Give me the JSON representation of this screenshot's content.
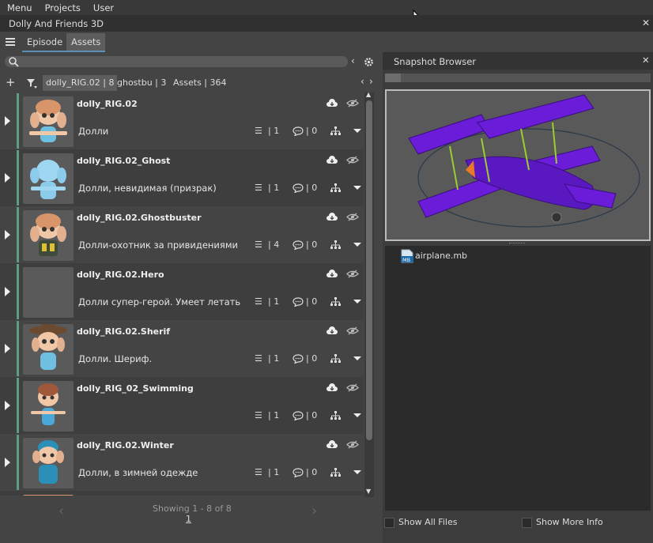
{
  "menubar": {
    "items": [
      "Menu",
      "Projects",
      "User"
    ]
  },
  "window": {
    "title": "Dolly And Friends 3D"
  },
  "tabs": [
    "Episode",
    "Assets"
  ],
  "filters": {
    "chips": [
      "dolly_RIG.02 | 8",
      "ghostbu | 3",
      "Assets | 364"
    ]
  },
  "assets": [
    {
      "name": "dolly_RIG.02",
      "description": "Долли",
      "versions": "1",
      "comments": "0"
    },
    {
      "name": "dolly_RIG.02_Ghost",
      "description": "Долли, невидимая (призрак)",
      "versions": "1",
      "comments": "0"
    },
    {
      "name": "dolly_RIG.02.Ghostbuster",
      "description": "Долли-охотник за привидениями",
      "versions": "4",
      "comments": "0"
    },
    {
      "name": "dolly_RIG.02.Hero",
      "description": "Долли супер-герой. Умеет летать",
      "versions": "1",
      "comments": "0"
    },
    {
      "name": "dolly_RIG.02.Sherif",
      "description": "Долли. Шериф.",
      "versions": "1",
      "comments": "0"
    },
    {
      "name": "dolly_RIG_02_Swimming",
      "description": "",
      "versions": "1",
      "comments": "0"
    },
    {
      "name": "dolly_RIG.02.Winter",
      "description": "Долли, в зимней одежде",
      "versions": "1",
      "comments": "0"
    }
  ],
  "pagination": {
    "showing": "Showing 1 - 8 of 8",
    "page": "1"
  },
  "snapshot": {
    "title": "Snapshot Browser",
    "progress_fraction": 0.06,
    "file": {
      "name": "airplane.mb",
      "badge": "MB"
    },
    "show_all_files": "Show All Files",
    "show_more_info": "Show More Info"
  },
  "colors": {
    "accent": "#5e9e80",
    "plane": "#6a1cd8",
    "tab_underline": "#5b8fb4"
  }
}
